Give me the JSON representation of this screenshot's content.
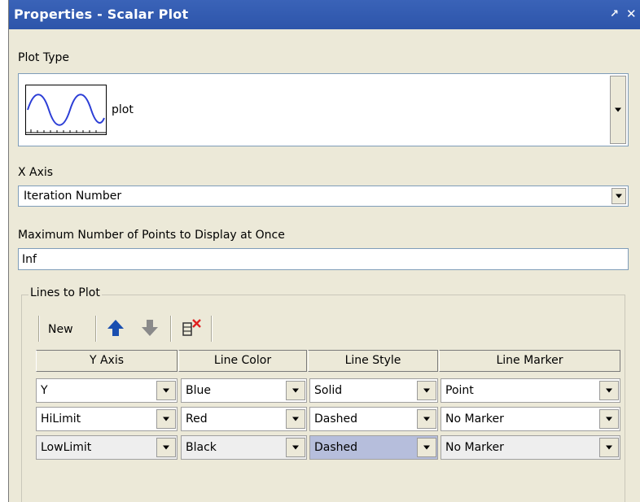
{
  "window": {
    "title": "Properties - Scalar Plot",
    "pin_glyph": "↗",
    "close_glyph": "✕"
  },
  "plot_type": {
    "label": "Plot Type",
    "value": "plot",
    "icon": "sine-wave-preview-icon"
  },
  "x_axis": {
    "label": "X Axis",
    "value": "Iteration Number"
  },
  "max_points": {
    "label": "Maximum Number of Points to Display at Once",
    "value": "Inf"
  },
  "lines": {
    "group_label": "Lines to Plot",
    "toolbar": {
      "new_label": "New",
      "icons": [
        "arrow-up-icon",
        "arrow-down-icon",
        "delete-rows-icon"
      ]
    },
    "columns": [
      "Y Axis",
      "Line Color",
      "Line Style",
      "Line Marker"
    ],
    "rows": [
      [
        "Y",
        "Blue",
        "Solid",
        "Point"
      ],
      [
        "HiLimit",
        "Red",
        "Dashed",
        "No Marker"
      ],
      [
        "LowLimit",
        "Black",
        "Dashed",
        "No Marker"
      ]
    ]
  },
  "colors": {
    "titlebar": "#2d55aa",
    "panel": "#ece9d8",
    "selection": "#b6bedc",
    "arrow_up": "#1a4fb0",
    "arrow_down": "#8a8a8a",
    "delete_x": "#e02020"
  }
}
